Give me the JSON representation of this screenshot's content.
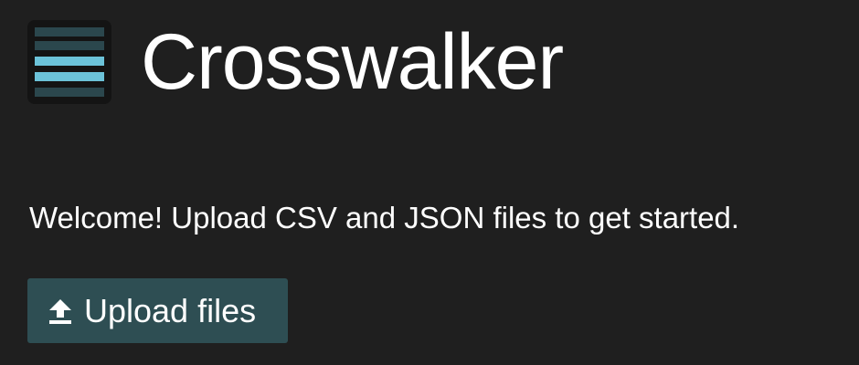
{
  "app": {
    "title": "Crosswalker",
    "logo_icon": "stacked-lines-logo-icon"
  },
  "welcome": {
    "message": "Welcome! Upload CSV and JSON files to get started."
  },
  "upload": {
    "label": "Upload files",
    "icon": "upload-arrow-icon"
  },
  "colors": {
    "background": "#1f1f1f",
    "text": "#ffffff",
    "button_bg": "#2e4e53",
    "logo_accent": "#6cc3d9",
    "logo_muted": "#2b474d"
  }
}
